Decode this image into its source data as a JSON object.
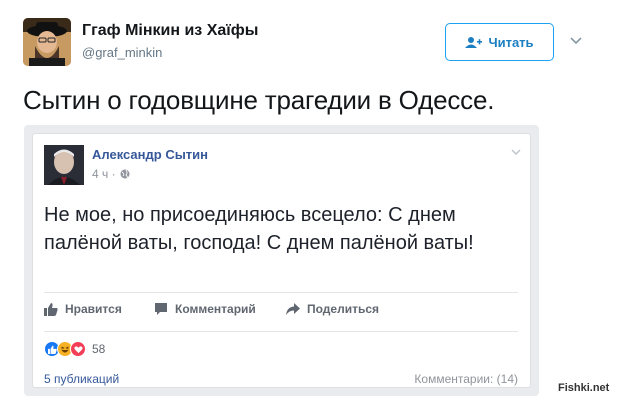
{
  "tweet": {
    "author_name": "Ггаф Мінкин из Хаїфы",
    "author_handle": "@graf_minkin",
    "follow_label": "Читать",
    "text": "Сытин о годовщине трагедии в Одессе."
  },
  "embedded_post": {
    "author_name": "Александр Сытин",
    "time": "4 ч ·",
    "text": "Не мое, но присоединяюсь всецело: С днем палёной ваты, господа! С днем палёной ваты!",
    "actions": {
      "like": "Нравится",
      "comment": "Комментарий",
      "share": "Поделиться"
    },
    "reactions_count": "58",
    "shares_label": "5 публикаций",
    "comments_label": "Комментарии: (14)"
  },
  "watermark": "Fishki.net",
  "colors": {
    "twitter_blue": "#1da1f2",
    "facebook_link": "#365899",
    "like": "#1877f2",
    "love": "#f33e58",
    "haha": "#f7b125"
  },
  "icons": [
    "follow-user-icon",
    "chevron-down-icon",
    "globe-icon",
    "like-icon",
    "comment-icon",
    "share-icon",
    "like-reaction-icon",
    "haha-reaction-icon",
    "love-reaction-icon"
  ]
}
